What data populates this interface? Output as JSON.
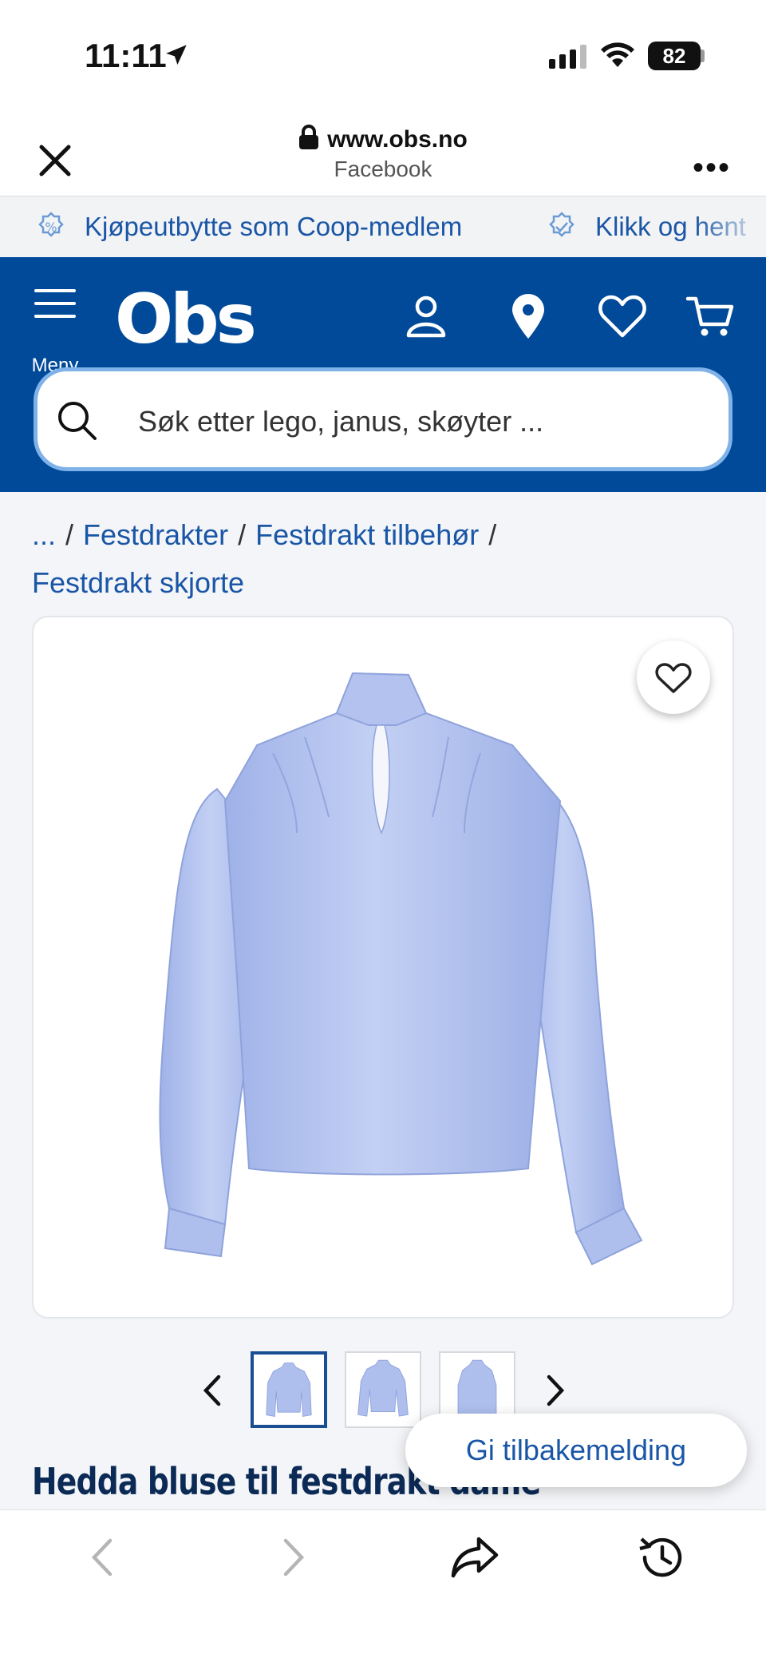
{
  "status_bar": {
    "time": "11:11",
    "battery": "82"
  },
  "browser": {
    "url": "www.obs.no",
    "source": "Facebook"
  },
  "usp": [
    {
      "icon": "percent-badge-icon",
      "label": "Kjøpeutbytte som Coop-medlem"
    },
    {
      "icon": "check-badge-icon",
      "label": "Klikk og hent"
    }
  ],
  "header": {
    "menu_label": "Meny",
    "logo": "Obs",
    "icons": [
      "user-icon",
      "location-pin-icon",
      "heart-icon",
      "cart-icon"
    ],
    "search_placeholder": "Søk etter lego, janus, skøyter ..."
  },
  "breadcrumb": {
    "ellipsis": "...",
    "items": [
      "Festdrakter",
      "Festdrakt tilbehør",
      "Festdrakt skjorte"
    ]
  },
  "product": {
    "title": "Hedda bluse til festdrakt dame",
    "image_color": "#aebfee",
    "thumbnail_count": 3,
    "active_thumbnail": 1
  },
  "feedback_button": "Gi tilbakemelding",
  "colors": {
    "brand_blue": "#004a99",
    "link_blue": "#1a56a6",
    "title_navy": "#0b2a55"
  }
}
